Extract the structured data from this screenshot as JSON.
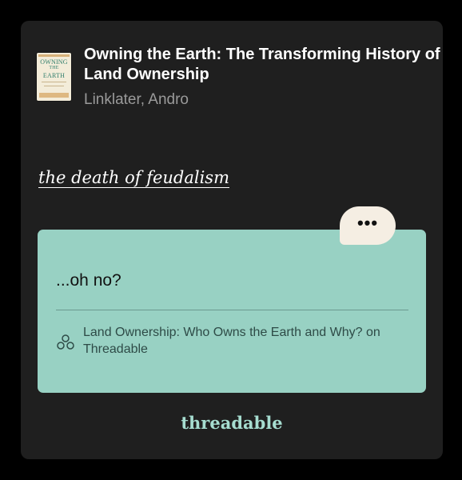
{
  "book": {
    "cover_lines": [
      "OWNING",
      "THE",
      "EARTH"
    ],
    "title": "Owning the Earth: The Transforming History of Land Ownership",
    "author": "Linklater, Andro"
  },
  "highlight": {
    "text": "the death of feudalism"
  },
  "comment": {
    "text": "...oh no?",
    "bubble_label": "•••",
    "thread_link": "Land Ownership: Who Owns the Earth and Why? on Threadable"
  },
  "brand": {
    "name": "threadable"
  },
  "colors": {
    "card_bg": "#1f1f1f",
    "comment_bg": "#98d1c3",
    "bubble_bg": "#f5eee3",
    "brand": "#a6ddd0"
  },
  "icons": {
    "thread": "threads-icon",
    "more": "ellipsis-icon"
  }
}
